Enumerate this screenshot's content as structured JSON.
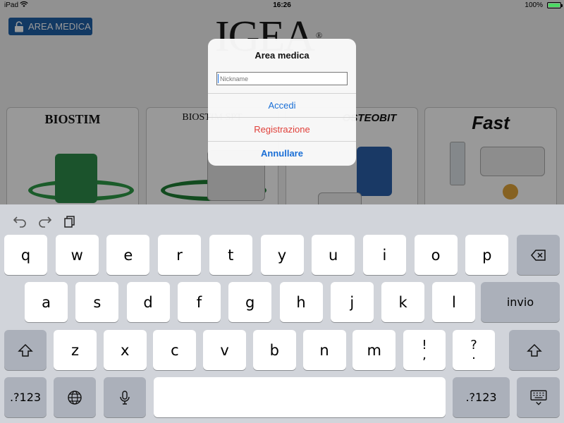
{
  "status_bar": {
    "carrier": "iPad",
    "time": "16:26",
    "battery": "100%"
  },
  "app": {
    "area_button": "AREA MEDICA",
    "logo": "IGEA",
    "logo_mark": "®",
    "products": [
      {
        "name": "BIOSTIM",
        "color": "#1e7d34"
      },
      {
        "name": "BIOSTIM SPT",
        "color": "#1e7d34"
      },
      {
        "name": "OSTEOBIT",
        "color": "#2b5fa8"
      },
      {
        "name": "Fast",
        "color": "#d9a23a"
      }
    ]
  },
  "alert": {
    "title": "Area medica",
    "input_placeholder": "Nickname",
    "input_value": "",
    "actions": {
      "login": "Accedi",
      "register": "Registrazione",
      "cancel": "Annullare"
    }
  },
  "keyboard": {
    "row1": [
      "q",
      "w",
      "e",
      "r",
      "t",
      "y",
      "u",
      "i",
      "o",
      "p"
    ],
    "row2": [
      "a",
      "s",
      "d",
      "f",
      "g",
      "h",
      "j",
      "k",
      "l"
    ],
    "row3": [
      "z",
      "x",
      "c",
      "v",
      "b",
      "n",
      "m"
    ],
    "return_label": "invio",
    "numbers_label": ".?123",
    "punct1_top": "!",
    "punct1_bottom": ",",
    "punct2_top": "?",
    "punct2_bottom": "."
  },
  "colors": {
    "accent": "#1a6fd6",
    "destructive": "#e0403a",
    "area_button_bg": "#1f5fa6"
  }
}
